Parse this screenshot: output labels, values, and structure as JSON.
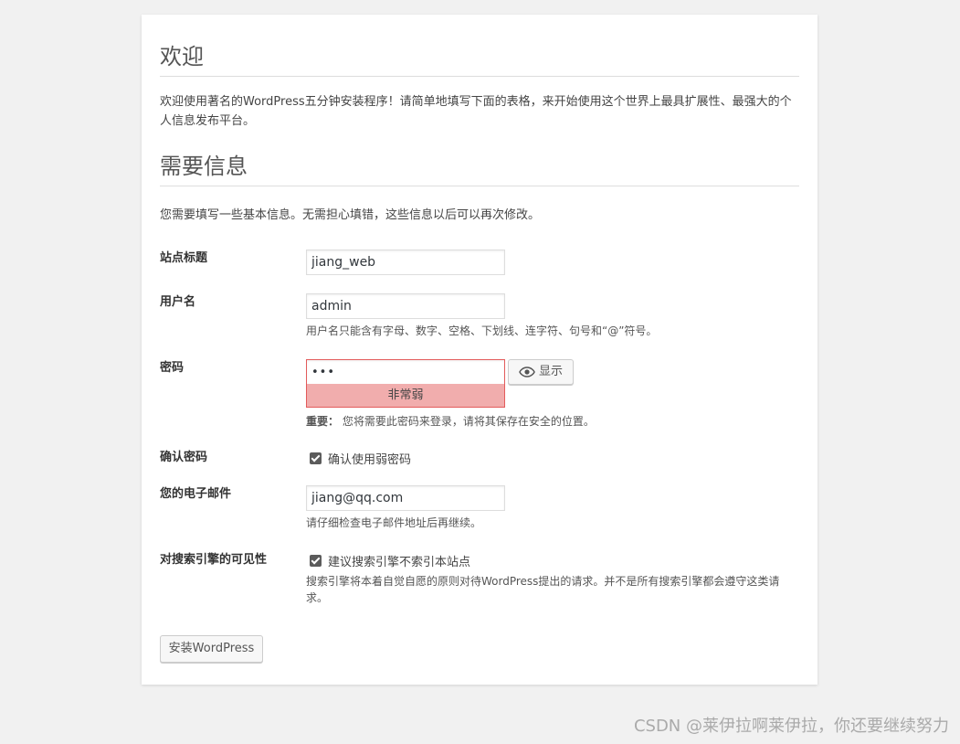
{
  "welcome": {
    "heading": "欢迎",
    "intro": "欢迎使用著名的WordPress五分钟安装程序！请简单地填写下面的表格，来开始使用这个世界上最具扩展性、最强大的个人信息发布平台。"
  },
  "info": {
    "heading": "需要信息",
    "intro": "您需要填写一些基本信息。无需担心填错，这些信息以后可以再次修改。"
  },
  "form": {
    "site_title": {
      "label": "站点标题",
      "value": "jiang_web"
    },
    "username": {
      "label": "用户名",
      "value": "admin",
      "hint": "用户名只能含有字母、数字、空格、下划线、连字符、句号和“@”符号。"
    },
    "password": {
      "label": "密码",
      "value": "•••",
      "strength": "非常弱",
      "show_label": "显示",
      "note_bold": "重要：",
      "note": "您将需要此密码来登录，请将其保存在安全的位置。"
    },
    "confirm_password": {
      "label": "确认密码",
      "checkbox_label": "确认使用弱密码"
    },
    "email": {
      "label": "您的电子邮件",
      "value": "jiang@qq.com",
      "hint": "请仔细检查电子邮件地址后再继续。"
    },
    "visibility": {
      "label": "对搜索引擎的可见性",
      "checkbox_label": "建议搜索引擎不索引本站点",
      "hint": "搜索引擎将本着自觉自愿的原则对待WordPress提出的请求。并不是所有搜索引擎都会遵守这类请求。"
    }
  },
  "install_button": "安装WordPress",
  "watermark": "CSDN @莱伊拉啊莱伊拉，你还要继续努力"
}
